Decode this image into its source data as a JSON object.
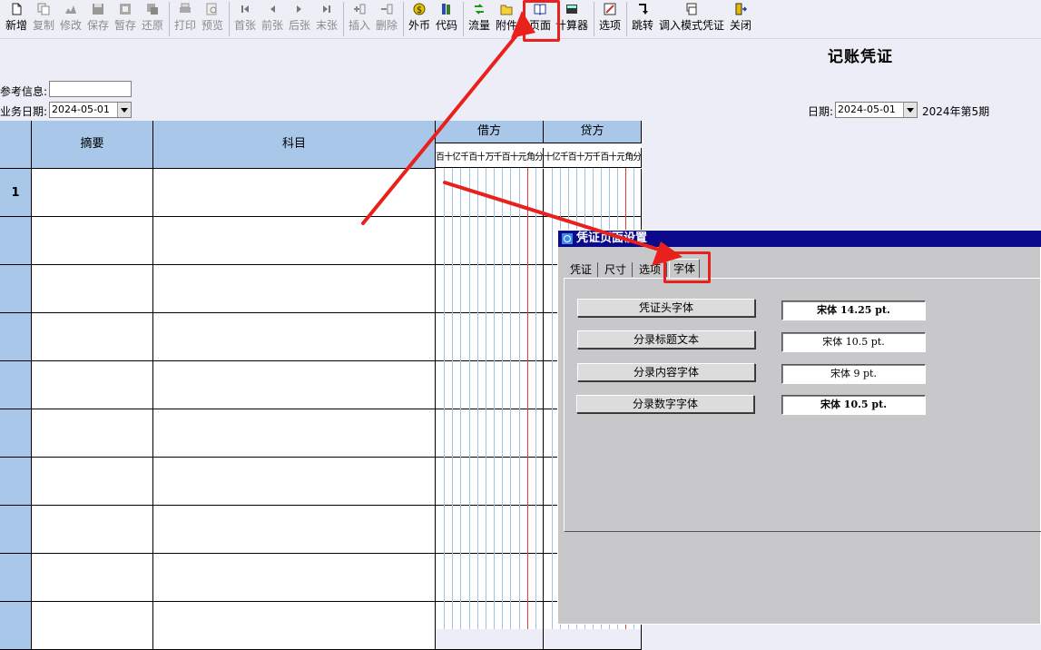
{
  "toolbar": {
    "items": [
      {
        "label": "新增",
        "icon": "new-file-icon"
      },
      {
        "label": "复制",
        "icon": "copy-icon"
      },
      {
        "label": "修改",
        "icon": "edit-icon"
      },
      {
        "label": "保存",
        "icon": "save-icon"
      },
      {
        "label": "暂存",
        "icon": "temp-save-icon"
      },
      {
        "label": "还原",
        "icon": "restore-icon"
      },
      {
        "label": "打印",
        "icon": "print-icon"
      },
      {
        "label": "预览",
        "icon": "preview-icon"
      },
      {
        "label": "首张",
        "icon": "first-icon"
      },
      {
        "label": "前张",
        "icon": "prev-icon"
      },
      {
        "label": "后张",
        "icon": "next-icon"
      },
      {
        "label": "末张",
        "icon": "last-icon"
      },
      {
        "label": "插入",
        "icon": "insert-icon"
      },
      {
        "label": "删除",
        "icon": "delete-icon"
      },
      {
        "label": "外币",
        "icon": "currency-icon"
      },
      {
        "label": "代码",
        "icon": "code-icon"
      },
      {
        "label": "流量",
        "icon": "flow-icon"
      },
      {
        "label": "附件",
        "icon": "folder-icon"
      },
      {
        "label": "页面",
        "icon": "book-icon"
      },
      {
        "label": "计算器",
        "icon": "calculator-icon"
      },
      {
        "label": "选项",
        "icon": "options-icon"
      },
      {
        "label": "跳转",
        "icon": "jump-icon"
      },
      {
        "label": "调入模式凭证",
        "icon": "template-icon"
      },
      {
        "label": "关闭",
        "icon": "close-door-icon"
      }
    ]
  },
  "voucher": {
    "title": "记账凭证",
    "ref_label": "参考信息:",
    "ref_value": "",
    "bizdate_label": "业务日期:",
    "bizdate_value": "2024-05-01",
    "date_label": "日期:",
    "date_value": "2024-05-01",
    "period": "2024年第5期"
  },
  "grid": {
    "col_summary": "摘要",
    "col_account": "科目",
    "debit": "借方",
    "credit": "贷方",
    "debit_digits": [
      "百",
      "十",
      "亿",
      "千",
      "百",
      "十",
      "万",
      "千",
      "百",
      "十",
      "元",
      "角",
      "分"
    ],
    "credit_digits": [
      "十",
      "亿",
      "千",
      "百",
      "十",
      "万",
      "千",
      "百",
      "十",
      "元",
      "角",
      "分"
    ],
    "rows": [
      "1",
      "",
      "",
      "",
      "",
      "",
      "",
      "",
      "",
      ""
    ]
  },
  "dialog": {
    "title": "凭证页面设置",
    "tabs": [
      "凭证",
      "尺寸",
      "选项",
      "字体"
    ],
    "active_tab": "字体",
    "fonts": [
      {
        "button": "凭证头字体",
        "value": "宋体 14.25 pt.",
        "bold": true
      },
      {
        "button": "分录标题文本",
        "value": "宋体 10.5 pt.",
        "bold": false
      },
      {
        "button": "分录内容字体",
        "value": "宋体 9 pt.",
        "bold": false
      },
      {
        "button": "分录数字字体",
        "value": "宋体 10.5 pt.",
        "bold": true
      }
    ]
  },
  "colors": {
    "header_blue": "#a9c7e8",
    "dialog_title": "#0b0a8a",
    "annotation_red": "#e8211d"
  }
}
